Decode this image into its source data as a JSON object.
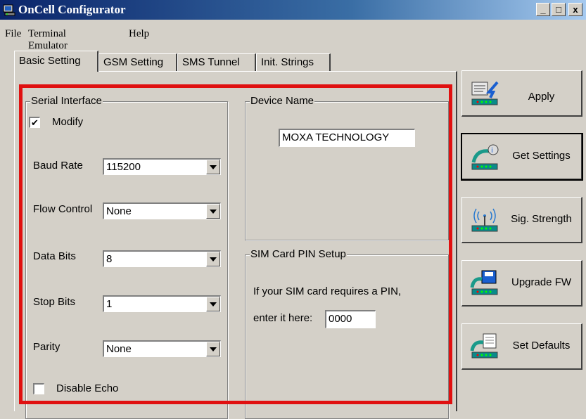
{
  "window": {
    "title": "OnCell Configurator",
    "minimize": "_",
    "maximize": "□",
    "close": "x"
  },
  "menu": [
    "File",
    "Terminal Emulator",
    "Help"
  ],
  "tabs": [
    "Basic Setting",
    "GSM Setting",
    "SMS Tunnel",
    "Init. Strings"
  ],
  "serial": {
    "title": "Serial Interface",
    "modify_label": "Modify",
    "modify_checked": true,
    "baud_label": "Baud Rate",
    "baud_value": "115200",
    "flow_label": "Flow Control",
    "flow_value": "None",
    "databits_label": "Data Bits",
    "databits_value": "8",
    "stopbits_label": "Stop Bits",
    "stopbits_value": "1",
    "parity_label": "Parity",
    "parity_value": "None",
    "echo_label": "Disable Echo",
    "echo_checked": false
  },
  "device": {
    "title": "Device Name",
    "value": "MOXA TECHNOLOGY"
  },
  "sim": {
    "title": "SIM Card PIN Setup",
    "line1": "If your SIM card requires a PIN,",
    "line2": "enter it here:",
    "pin": "0000"
  },
  "buttons": {
    "apply": "Apply",
    "get_settings": "Get Settings",
    "sig_strength": "Sig. Strength",
    "upgrade_fw": "Upgrade FW",
    "set_defaults": "Set Defaults"
  },
  "highlight_color": "#e01010"
}
